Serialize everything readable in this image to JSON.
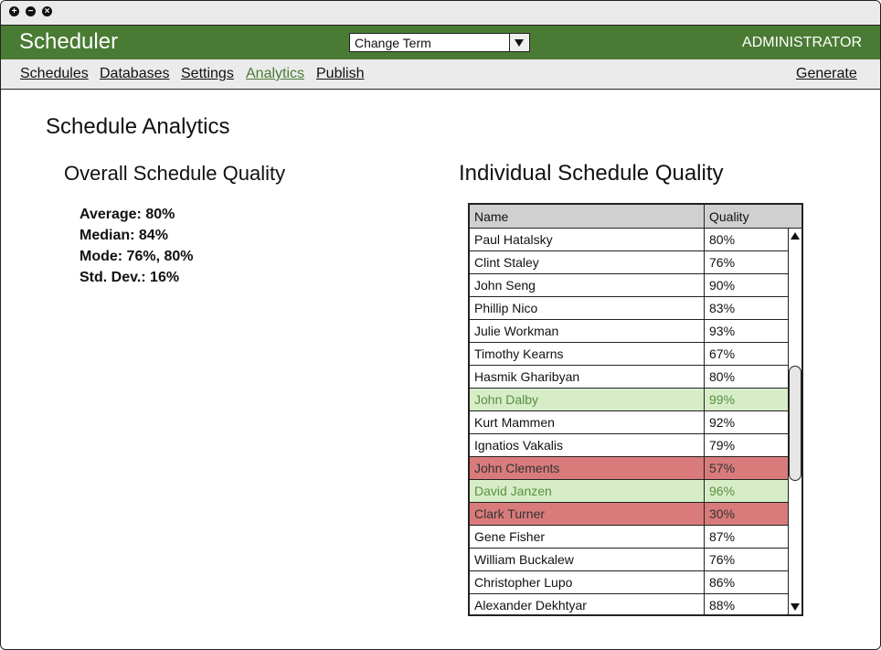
{
  "window": {
    "controls": [
      "+",
      "−",
      "×"
    ]
  },
  "header": {
    "app_title": "Scheduler",
    "term_select": {
      "value": "Change Term"
    },
    "user_role": "ADMINISTRATOR",
    "brand_color": "#4a7b34"
  },
  "nav": {
    "items": [
      {
        "label": "Schedules",
        "active": false
      },
      {
        "label": "Databases",
        "active": false
      },
      {
        "label": "Settings",
        "active": false
      },
      {
        "label": "Analytics",
        "active": true
      },
      {
        "label": "Publish",
        "active": false
      }
    ],
    "generate_label": "Generate"
  },
  "page": {
    "title": "Schedule Analytics",
    "overall_title": "Overall Schedule Quality",
    "individual_title": "Individual Schedule Quality"
  },
  "stats": {
    "average": "Average: 80%",
    "median": "Median: 84%",
    "mode": "Mode: 76%, 80%",
    "stddev": "Std. Dev.: 16%"
  },
  "table": {
    "headers": {
      "name": "Name",
      "quality": "Quality"
    },
    "rows": [
      {
        "name": "Paul Hatalsky",
        "quality": "80%",
        "status": "normal"
      },
      {
        "name": "Clint Staley",
        "quality": "76%",
        "status": "normal"
      },
      {
        "name": "John Seng",
        "quality": "90%",
        "status": "normal"
      },
      {
        "name": "Phillip Nico",
        "quality": "83%",
        "status": "normal"
      },
      {
        "name": "Julie Workman",
        "quality": "93%",
        "status": "normal"
      },
      {
        "name": "Timothy Kearns",
        "quality": "67%",
        "status": "normal"
      },
      {
        "name": "Hasmik Gharibyan",
        "quality": "80%",
        "status": "normal"
      },
      {
        "name": "John Dalby",
        "quality": "99%",
        "status": "good"
      },
      {
        "name": "Kurt Mammen",
        "quality": "92%",
        "status": "normal"
      },
      {
        "name": "Ignatios Vakalis",
        "quality": "79%",
        "status": "normal"
      },
      {
        "name": "John Clements",
        "quality": "57%",
        "status": "bad"
      },
      {
        "name": "David Janzen",
        "quality": "96%",
        "status": "good"
      },
      {
        "name": "Clark Turner",
        "quality": "30%",
        "status": "bad"
      },
      {
        "name": "Gene Fisher",
        "quality": "87%",
        "status": "normal"
      },
      {
        "name": "William Buckalew",
        "quality": "76%",
        "status": "normal"
      },
      {
        "name": "Christopher Lupo",
        "quality": "86%",
        "status": "normal"
      },
      {
        "name": "Alexander Dekhtyar",
        "quality": "88%",
        "status": "normal"
      }
    ],
    "status_colors": {
      "good": "#d6edc8",
      "bad": "#d97b7b"
    }
  }
}
